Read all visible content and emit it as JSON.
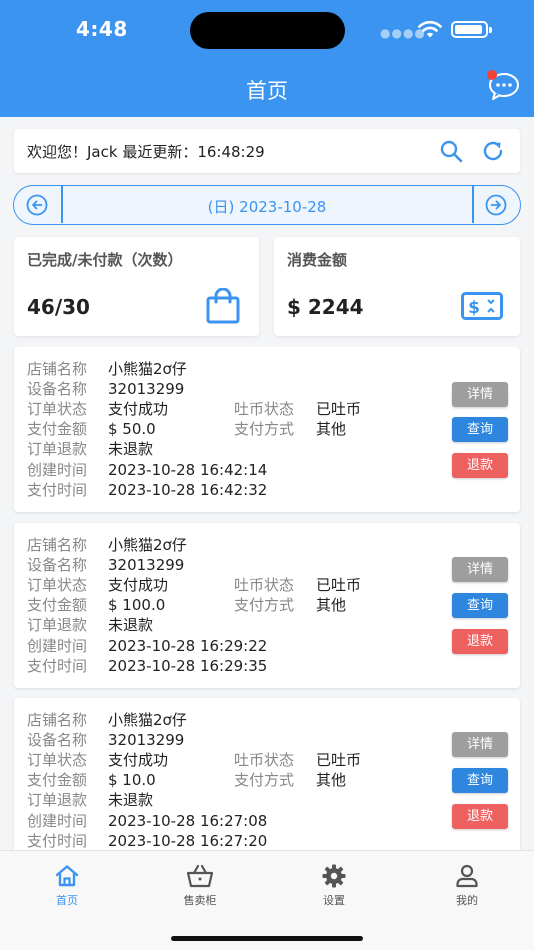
{
  "status_bar": {
    "time": "4:48"
  },
  "header": {
    "title": "首页"
  },
  "welcome": {
    "text": "欢迎您！Jack 最近更新：16:48:29"
  },
  "date_nav": {
    "date": "(日) 2023-10-28"
  },
  "stats": [
    {
      "label": "已完成/未付款（次数）",
      "value": "46/30",
      "icon": "shopping-bag-icon"
    },
    {
      "label": "消费金额",
      "value": "$ 2244",
      "icon": "money-icon"
    }
  ],
  "field_labels": {
    "shop": "店铺名称",
    "device": "设备名称",
    "order_status": "订单状态",
    "coin_status": "吐币状态",
    "pay_amount": "支付金额",
    "pay_method": "支付方式",
    "refund": "订单退款",
    "created": "创建时间",
    "paid": "支付时间"
  },
  "buttons": {
    "detail": "详情",
    "query": "查询",
    "refund": "退款"
  },
  "orders": [
    {
      "shop": "小熊猫2ơ仔",
      "device": "32013299",
      "order_status": "支付成功",
      "coin_status": "已吐币",
      "pay_amount": "$ 50.0",
      "pay_method": "其他",
      "refund": "未退款",
      "created": "2023-10-28 16:42:14",
      "paid": "2023-10-28 16:42:32"
    },
    {
      "shop": "小熊猫2ơ仔",
      "device": "32013299",
      "order_status": "支付成功",
      "coin_status": "已吐币",
      "pay_amount": "$ 100.0",
      "pay_method": "其他",
      "refund": "未退款",
      "created": "2023-10-28 16:29:22",
      "paid": "2023-10-28 16:29:35"
    },
    {
      "shop": "小熊猫2ơ仔",
      "device": "32013299",
      "order_status": "支付成功",
      "coin_status": "已吐币",
      "pay_amount": "$ 10.0",
      "pay_method": "其他",
      "refund": "未退款",
      "created": "2023-10-28 16:27:08",
      "paid": "2023-10-28 16:27:20"
    }
  ],
  "tabs": [
    {
      "label": "首页",
      "icon": "home-icon",
      "active": true
    },
    {
      "label": "售卖柜",
      "icon": "basket-icon",
      "active": false
    },
    {
      "label": "设置",
      "icon": "gear-icon",
      "active": false
    },
    {
      "label": "我的",
      "icon": "user-icon",
      "active": false
    }
  ],
  "colors": {
    "primary": "#3b94ef",
    "detail": "#9e9e9e",
    "query": "#2e86de",
    "refund": "#ef6161"
  }
}
